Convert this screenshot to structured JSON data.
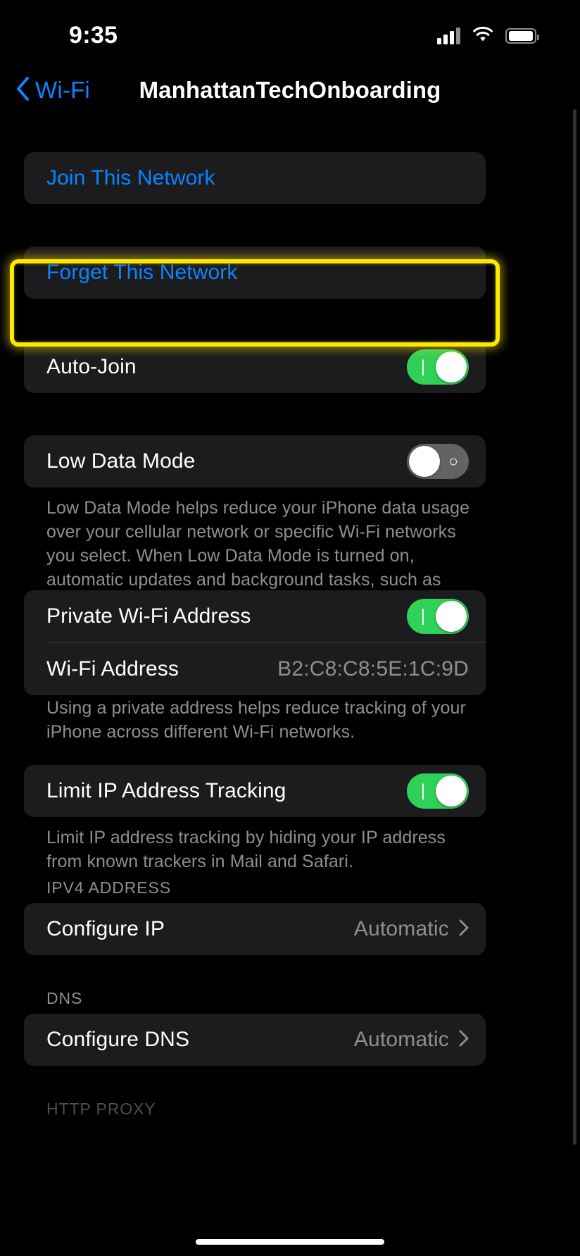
{
  "status_bar": {
    "time": "9:35",
    "cellular_icon": "cellular-signal-icon",
    "wifi_icon": "wifi-icon",
    "battery_icon": "battery-icon"
  },
  "nav_bar": {
    "back_icon": "chevron-left-icon",
    "back_label": "Wi-Fi",
    "title": "ManhattanTechOnboarding"
  },
  "actions": {
    "join": "Join This Network",
    "forget": "Forget This Network"
  },
  "highlight": {
    "color": "#ffe800",
    "target": "Forget This Network"
  },
  "settings": {
    "auto_join": {
      "label": "Auto-Join",
      "state": "on",
      "on_glyph": "|",
      "off_glyph": "○"
    },
    "low_data_mode": {
      "label": "Low Data Mode",
      "state": "off",
      "on_glyph": "|",
      "off_glyph": "○",
      "footnote": "Low Data Mode helps reduce your iPhone data usage over your cellular network or specific Wi-Fi networks you select. When Low Data Mode is turned on, automatic updates and background tasks, such as Photos syncing, are paused."
    },
    "private_wifi_address": {
      "label": "Private Wi-Fi Address",
      "state": "on",
      "on_glyph": "|",
      "address_label": "Wi-Fi Address",
      "address_value": "B2:C8:C8:5E:1C:9D",
      "footnote": "Using a private address helps reduce tracking of your iPhone across different Wi-Fi networks."
    },
    "limit_ip_tracking": {
      "label": "Limit IP Address Tracking",
      "state": "on",
      "on_glyph": "|",
      "footnote": "Limit IP address tracking by hiding your IP address from known trackers in Mail and Safari."
    }
  },
  "ipv4_section": {
    "header": "IPV4 ADDRESS",
    "configure_ip_label": "Configure IP",
    "configure_ip_value": "Automatic",
    "disclosure_icon": "chevron-right-icon"
  },
  "dns_section": {
    "header": "DNS",
    "configure_dns_label": "Configure DNS",
    "configure_dns_value": "Automatic",
    "disclosure_icon": "chevron-right-icon"
  },
  "http_proxy_section": {
    "header": "HTTP PROXY"
  },
  "colors": {
    "accent_blue": "#0a84ff",
    "switch_on_green": "#30d158",
    "switch_off_gray": "#636366",
    "card_background": "#1c1c1e",
    "secondary_text": "#8e8e93",
    "page_background": "#000000"
  }
}
